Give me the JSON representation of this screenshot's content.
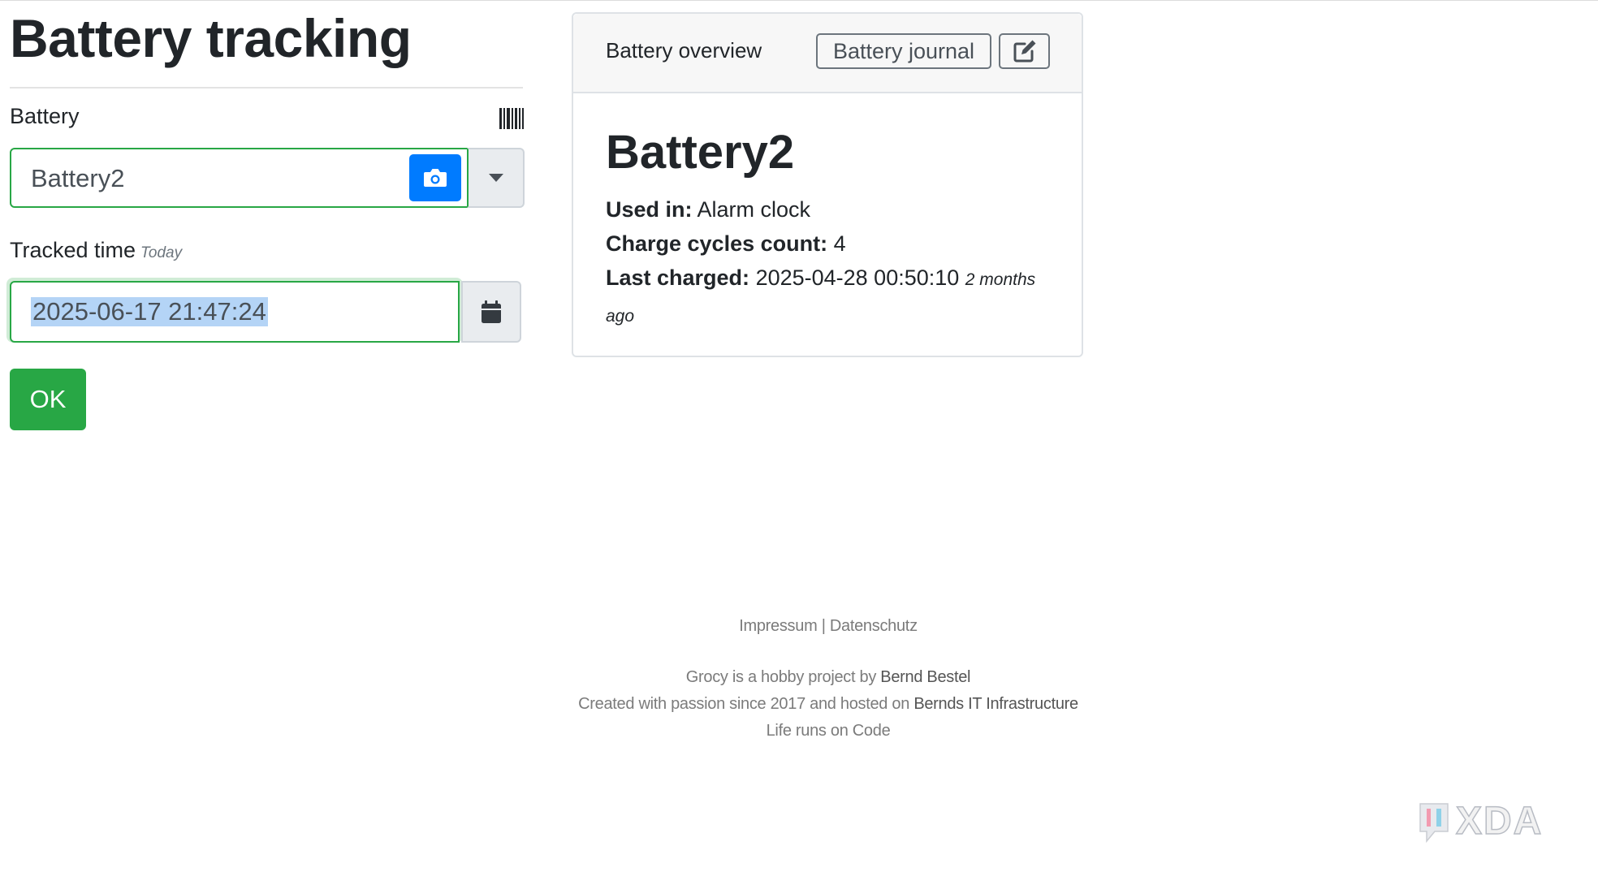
{
  "page_title": "Battery tracking",
  "form": {
    "battery_label": "Battery",
    "battery_value": "Battery2",
    "tracked_time_label": "Tracked time",
    "tracked_time_hint": "Today",
    "tracked_time_value": "2025-06-17 21:47:24",
    "ok_label": "OK"
  },
  "card": {
    "header_title": "Battery overview",
    "journal_label": "Battery journal",
    "name": "Battery2",
    "used_in_label": "Used in:",
    "used_in_value": "Alarm clock",
    "charge_cycles_label": "Charge cycles count:",
    "charge_cycles_value": "4",
    "last_charged_label": "Last charged:",
    "last_charged_value": "2025-04-28 00:50:10",
    "last_charged_relative": "2 months ago"
  },
  "footer": {
    "impressum": "Impressum",
    "separator": "|",
    "datenschutz": "Datenschutz",
    "line1_prefix": "Grocy is a hobby project by",
    "line1_link": "Bernd Bestel",
    "line2_prefix": "Created with passion since 2017 and hosted on",
    "line2_link": "Bernds IT Infrastructure",
    "line3": "Life runs on Code"
  },
  "watermark": {
    "text": "XDA"
  },
  "icons": {
    "barcode": "barcode-icon",
    "camera": "camera-icon",
    "dropdown": "caret-down-icon",
    "calendar": "calendar-icon",
    "edit": "edit-icon"
  },
  "colors": {
    "primary": "#007bff",
    "success": "#28a745",
    "selection": "#b4d4f6"
  }
}
